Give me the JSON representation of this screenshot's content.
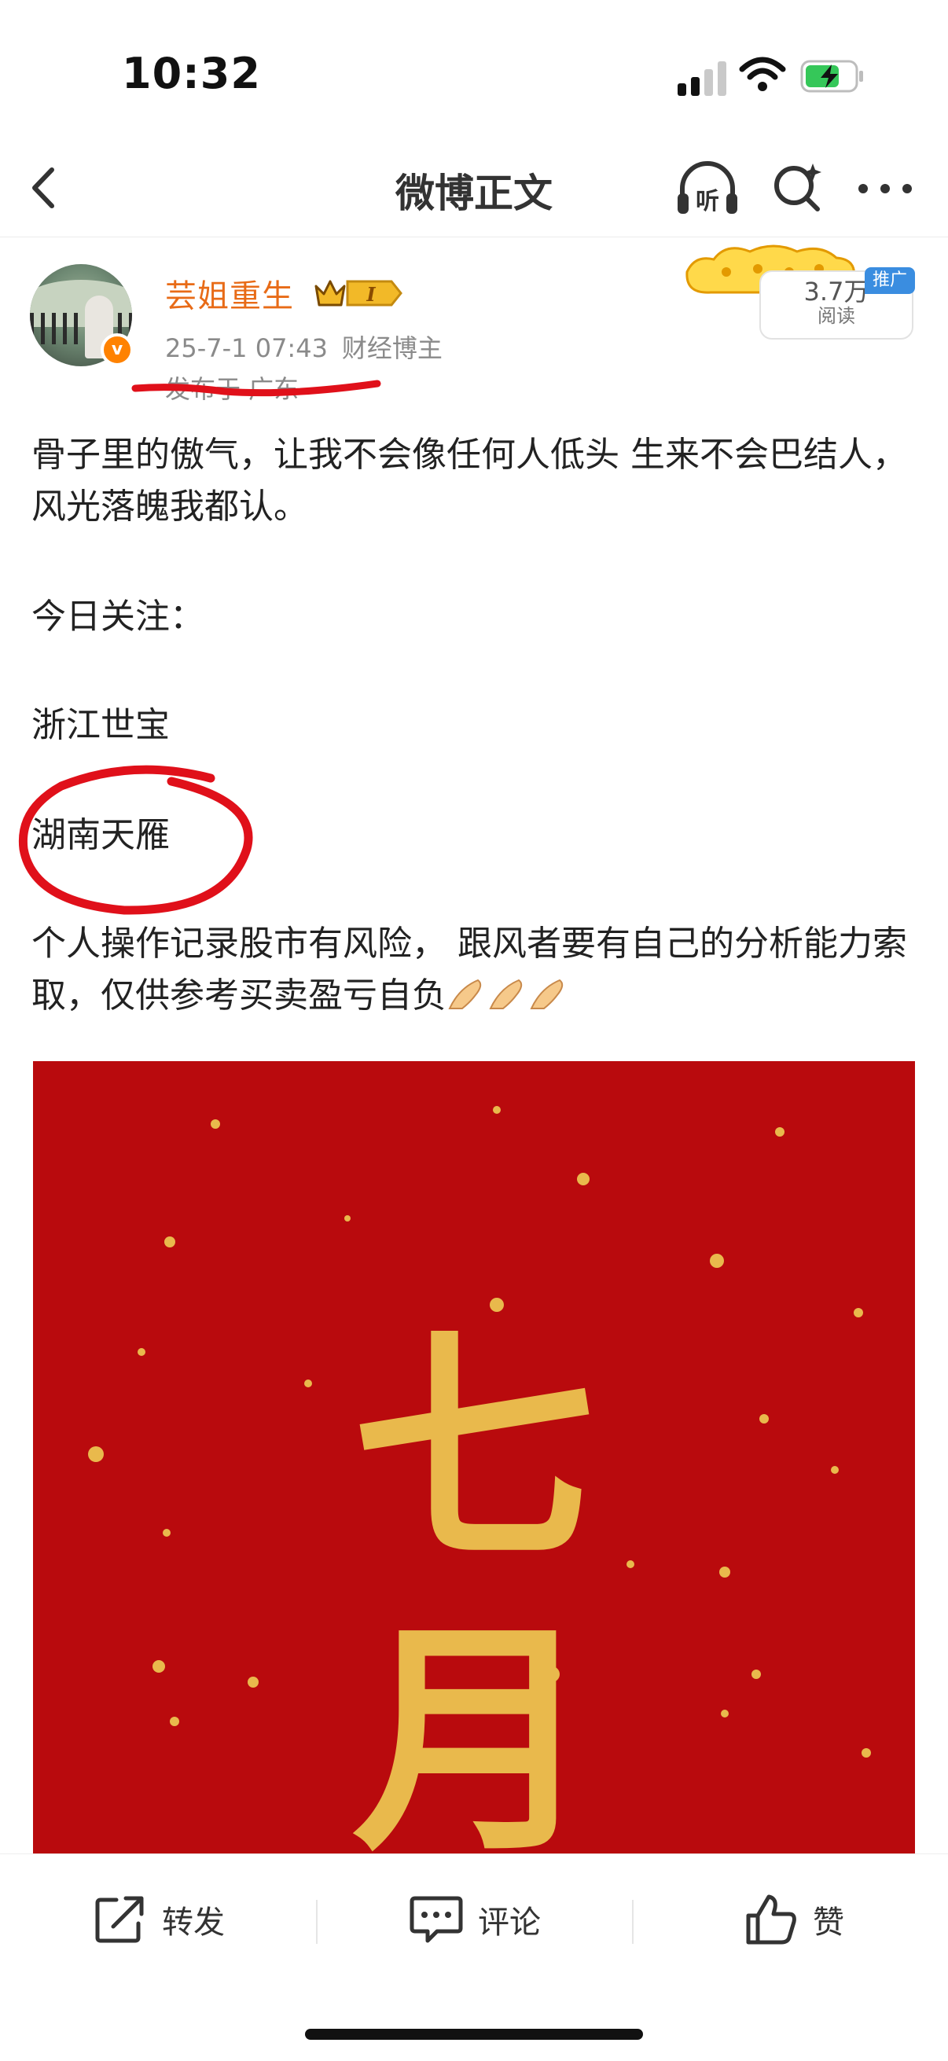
{
  "status_bar": {
    "time": "10:32"
  },
  "nav": {
    "title": "微博正文",
    "listen_label": "听"
  },
  "post": {
    "author": "芸姐重生",
    "member_level": "I",
    "verified_mark": "v",
    "date": "25-7-1 07:43",
    "author_tag": "财经博主",
    "location": "发布于 广东",
    "reads": "3.7万",
    "reads_label": "阅读",
    "promo_tag": "推广",
    "paragraphs": [
      "骨子里的傲气，让我不会像任何人低头 生来不会巴结人，风光落魄我都认。",
      "今日关注：",
      "浙江世宝",
      "湖南天雁",
      "个人操作记录股市有风险， 跟风者要有自己的分析能力索取，仅供参考买卖盈亏自负"
    ],
    "image_text": [
      "七",
      "月"
    ]
  },
  "actions": {
    "repost": "转发",
    "comment": "评论",
    "like": "赞"
  },
  "colors": {
    "username": "#e86b17",
    "image_bg": "#b90a0d",
    "image_gold": "#e9b94c",
    "annotation_red": "#e0101a"
  }
}
